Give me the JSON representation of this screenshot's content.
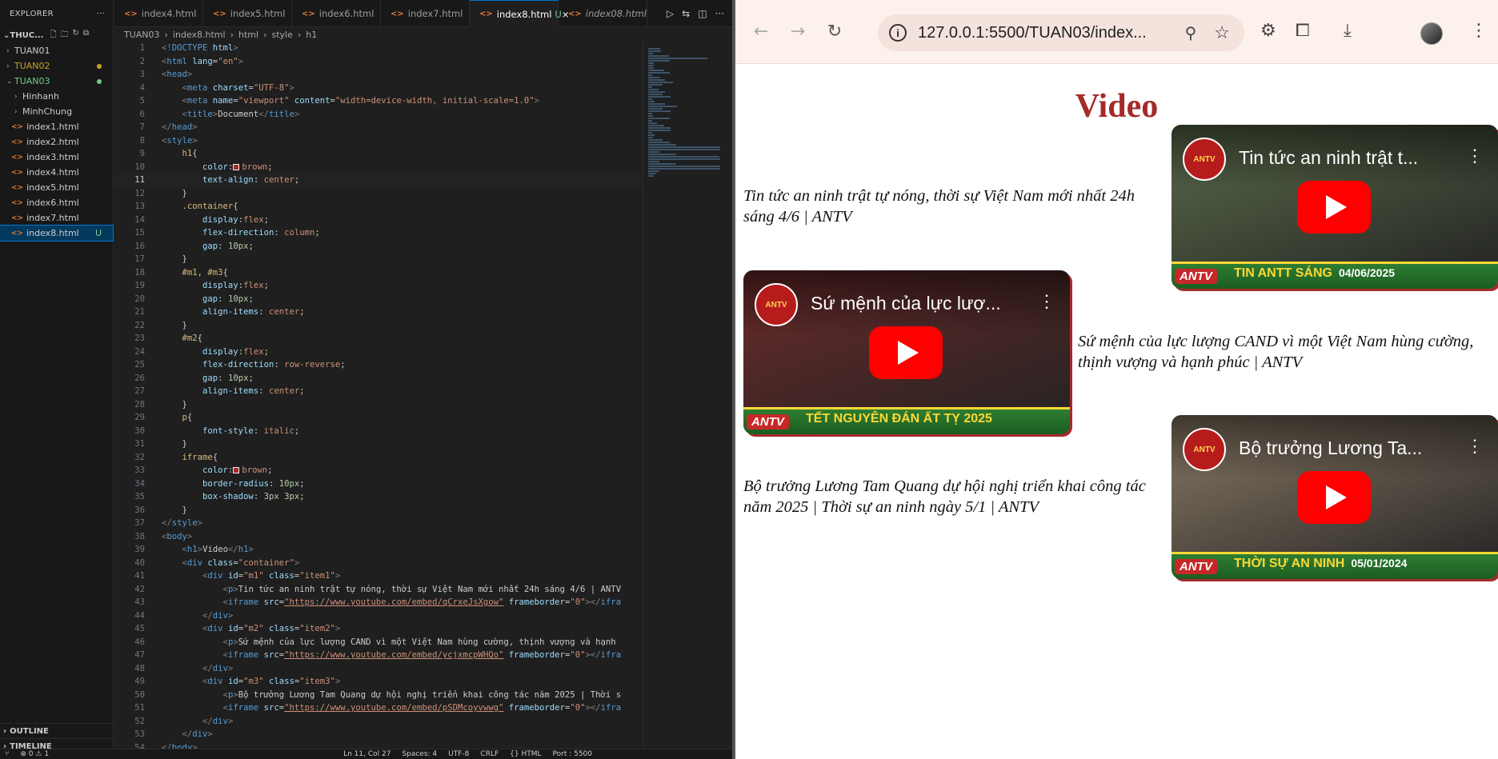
{
  "explorer": {
    "title": "EXPLORER",
    "root": "THUC...",
    "items": [
      {
        "label": "TUAN01",
        "kind": "folder",
        "color": "#cccccc"
      },
      {
        "label": "TUAN02",
        "kind": "folder",
        "color": "#c9a227"
      },
      {
        "label": "TUAN03",
        "kind": "folder-open",
        "color": "#73c991"
      },
      {
        "label": "Hinhanh",
        "kind": "folder",
        "color": "#cccccc"
      },
      {
        "label": "MinhChung",
        "kind": "folder",
        "color": "#cccccc"
      },
      {
        "label": "index1.html",
        "kind": "file",
        "color": "#cccccc"
      },
      {
        "label": "index2.html",
        "kind": "file",
        "color": "#cccccc"
      },
      {
        "label": "index3.html",
        "kind": "file",
        "color": "#cccccc"
      },
      {
        "label": "index4.html",
        "kind": "file",
        "color": "#cccccc"
      },
      {
        "label": "index5.html",
        "kind": "file",
        "color": "#cccccc"
      },
      {
        "label": "index6.html",
        "kind": "file",
        "color": "#cccccc"
      },
      {
        "label": "index7.html",
        "kind": "file",
        "color": "#cccccc"
      },
      {
        "label": "index8.html",
        "kind": "file",
        "color": "#cccccc",
        "badge": "U",
        "selected": true
      }
    ],
    "outline": "OUTLINE",
    "timeline": "TIMELINE"
  },
  "tabs": [
    {
      "label": "index4.html"
    },
    {
      "label": "index5.html"
    },
    {
      "label": "index6.html"
    },
    {
      "label": "index7.html"
    },
    {
      "label": "index8.html",
      "active": true,
      "badge": "U"
    },
    {
      "label": "index08.html",
      "italic": true
    }
  ],
  "breadcrumb": [
    "TUAN03",
    "index8.html",
    "html",
    "style",
    "h1"
  ],
  "code": {
    "current_line": 11,
    "lines": [
      [
        [
          "c-br",
          "<!"
        ],
        [
          "c-tag",
          "DOCTYPE"
        ],
        [
          "c-attr",
          " html"
        ],
        [
          "c-br",
          ">"
        ]
      ],
      [
        [
          "c-br",
          "<"
        ],
        [
          "c-tag",
          "html"
        ],
        [
          "c-attr",
          " lang"
        ],
        [
          "c-punc",
          "="
        ],
        [
          "c-str",
          "\"en\""
        ],
        [
          "c-br",
          ">"
        ]
      ],
      [
        [
          "c-br",
          "<"
        ],
        [
          "c-tag",
          "head"
        ],
        [
          "c-br",
          ">"
        ]
      ],
      [
        [
          "c-txt",
          "    "
        ],
        [
          "c-br",
          "<"
        ],
        [
          "c-tag",
          "meta"
        ],
        [
          "c-attr",
          " charset"
        ],
        [
          "c-punc",
          "="
        ],
        [
          "c-str",
          "\"UTF-8\""
        ],
        [
          "c-br",
          ">"
        ]
      ],
      [
        [
          "c-txt",
          "    "
        ],
        [
          "c-br",
          "<"
        ],
        [
          "c-tag",
          "meta"
        ],
        [
          "c-attr",
          " name"
        ],
        [
          "c-punc",
          "="
        ],
        [
          "c-str",
          "\"viewport\""
        ],
        [
          "c-attr",
          " content"
        ],
        [
          "c-punc",
          "="
        ],
        [
          "c-str",
          "\"width=device-width, initial-scale=1.0\""
        ],
        [
          "c-br",
          ">"
        ]
      ],
      [
        [
          "c-txt",
          "    "
        ],
        [
          "c-br",
          "<"
        ],
        [
          "c-tag",
          "title"
        ],
        [
          "c-br",
          ">"
        ],
        [
          "c-txt",
          "Document"
        ],
        [
          "c-br",
          "</"
        ],
        [
          "c-tag",
          "title"
        ],
        [
          "c-br",
          ">"
        ]
      ],
      [
        [
          "c-br",
          "</"
        ],
        [
          "c-tag",
          "head"
        ],
        [
          "c-br",
          ">"
        ]
      ],
      [
        [
          "c-br",
          "<"
        ],
        [
          "c-tag",
          "style"
        ],
        [
          "c-br",
          ">"
        ]
      ],
      [
        [
          "c-txt",
          "    "
        ],
        [
          "c-sel",
          "h1"
        ],
        [
          "c-punc",
          "{"
        ]
      ],
      [
        [
          "c-txt",
          "        "
        ],
        [
          "c-prop",
          "color"
        ],
        [
          "c-punc",
          ":"
        ],
        [
          "swatch",
          ""
        ],
        [
          "c-val",
          "brown"
        ],
        [
          "c-punc",
          ";"
        ]
      ],
      [
        [
          "c-txt",
          "        "
        ],
        [
          "c-prop",
          "text-align"
        ],
        [
          "c-punc",
          ": "
        ],
        [
          "c-val",
          "center"
        ],
        [
          "c-punc",
          ";"
        ]
      ],
      [
        [
          "c-txt",
          "    "
        ],
        [
          "c-punc",
          "}"
        ]
      ],
      [
        [
          "c-txt",
          "    "
        ],
        [
          "c-sel",
          ".container"
        ],
        [
          "c-punc",
          "{"
        ]
      ],
      [
        [
          "c-txt",
          "        "
        ],
        [
          "c-prop",
          "display"
        ],
        [
          "c-punc",
          ":"
        ],
        [
          "c-val",
          "flex"
        ],
        [
          "c-punc",
          ";"
        ]
      ],
      [
        [
          "c-txt",
          "        "
        ],
        [
          "c-prop",
          "flex-direction"
        ],
        [
          "c-punc",
          ": "
        ],
        [
          "c-val",
          "column"
        ],
        [
          "c-punc",
          ";"
        ]
      ],
      [
        [
          "c-txt",
          "        "
        ],
        [
          "c-prop",
          "gap"
        ],
        [
          "c-punc",
          ": "
        ],
        [
          "c-num",
          "10px"
        ],
        [
          "c-punc",
          ";"
        ]
      ],
      [
        [
          "c-txt",
          "    "
        ],
        [
          "c-punc",
          "}"
        ]
      ],
      [
        [
          "c-txt",
          "    "
        ],
        [
          "c-sel",
          "#m1, #m3"
        ],
        [
          "c-punc",
          "{"
        ]
      ],
      [
        [
          "c-txt",
          "        "
        ],
        [
          "c-prop",
          "display"
        ],
        [
          "c-punc",
          ":"
        ],
        [
          "c-val",
          "flex"
        ],
        [
          "c-punc",
          ";"
        ]
      ],
      [
        [
          "c-txt",
          "        "
        ],
        [
          "c-prop",
          "gap"
        ],
        [
          "c-punc",
          ": "
        ],
        [
          "c-num",
          "10px"
        ],
        [
          "c-punc",
          ";"
        ]
      ],
      [
        [
          "c-txt",
          "        "
        ],
        [
          "c-prop",
          "align-items"
        ],
        [
          "c-punc",
          ": "
        ],
        [
          "c-val",
          "center"
        ],
        [
          "c-punc",
          ";"
        ]
      ],
      [
        [
          "c-txt",
          "    "
        ],
        [
          "c-punc",
          "}"
        ]
      ],
      [
        [
          "c-txt",
          "    "
        ],
        [
          "c-sel",
          "#m2"
        ],
        [
          "c-punc",
          "{"
        ]
      ],
      [
        [
          "c-txt",
          "        "
        ],
        [
          "c-prop",
          "display"
        ],
        [
          "c-punc",
          ":"
        ],
        [
          "c-val",
          "flex"
        ],
        [
          "c-punc",
          ";"
        ]
      ],
      [
        [
          "c-txt",
          "        "
        ],
        [
          "c-prop",
          "flex-direction"
        ],
        [
          "c-punc",
          ": "
        ],
        [
          "c-val",
          "row-reverse"
        ],
        [
          "c-punc",
          ";"
        ]
      ],
      [
        [
          "c-txt",
          "        "
        ],
        [
          "c-prop",
          "gap"
        ],
        [
          "c-punc",
          ": "
        ],
        [
          "c-num",
          "10px"
        ],
        [
          "c-punc",
          ";"
        ]
      ],
      [
        [
          "c-txt",
          "        "
        ],
        [
          "c-prop",
          "align-items"
        ],
        [
          "c-punc",
          ": "
        ],
        [
          "c-val",
          "center"
        ],
        [
          "c-punc",
          ";"
        ]
      ],
      [
        [
          "c-txt",
          "    "
        ],
        [
          "c-punc",
          "}"
        ]
      ],
      [
        [
          "c-txt",
          "    "
        ],
        [
          "c-sel",
          "p"
        ],
        [
          "c-punc",
          "{"
        ]
      ],
      [
        [
          "c-txt",
          "        "
        ],
        [
          "c-prop",
          "font-style"
        ],
        [
          "c-punc",
          ": "
        ],
        [
          "c-val",
          "italic"
        ],
        [
          "c-punc",
          ";"
        ]
      ],
      [
        [
          "c-txt",
          "    "
        ],
        [
          "c-punc",
          "}"
        ]
      ],
      [
        [
          "c-txt",
          "    "
        ],
        [
          "c-sel",
          "iframe"
        ],
        [
          "c-punc",
          "{"
        ]
      ],
      [
        [
          "c-txt",
          "        "
        ],
        [
          "c-prop",
          "color"
        ],
        [
          "c-punc",
          ":"
        ],
        [
          "swatch",
          ""
        ],
        [
          "c-val",
          "brown"
        ],
        [
          "c-punc",
          ";"
        ]
      ],
      [
        [
          "c-txt",
          "        "
        ],
        [
          "c-prop",
          "border-radius"
        ],
        [
          "c-punc",
          ": "
        ],
        [
          "c-num",
          "10px"
        ],
        [
          "c-punc",
          ";"
        ]
      ],
      [
        [
          "c-txt",
          "        "
        ],
        [
          "c-prop",
          "box-shadow"
        ],
        [
          "c-punc",
          ": "
        ],
        [
          "c-num",
          "3px 3px"
        ],
        [
          "c-punc",
          ";"
        ]
      ],
      [
        [
          "c-txt",
          "    "
        ],
        [
          "c-punc",
          "}"
        ]
      ],
      [
        [
          "c-br",
          "</"
        ],
        [
          "c-tag",
          "style"
        ],
        [
          "c-br",
          ">"
        ]
      ],
      [
        [
          "c-br",
          "<"
        ],
        [
          "c-tag",
          "body"
        ],
        [
          "c-br",
          ">"
        ]
      ],
      [
        [
          "c-txt",
          "    "
        ],
        [
          "c-br",
          "<"
        ],
        [
          "c-tag",
          "h1"
        ],
        [
          "c-br",
          ">"
        ],
        [
          "c-txt",
          "Video"
        ],
        [
          "c-br",
          "</"
        ],
        [
          "c-tag",
          "h1"
        ],
        [
          "c-br",
          ">"
        ]
      ],
      [
        [
          "c-txt",
          "    "
        ],
        [
          "c-br",
          "<"
        ],
        [
          "c-tag",
          "div"
        ],
        [
          "c-attr",
          " class"
        ],
        [
          "c-punc",
          "="
        ],
        [
          "c-str",
          "\"container\""
        ],
        [
          "c-br",
          ">"
        ]
      ],
      [
        [
          "c-txt",
          "        "
        ],
        [
          "c-br",
          "<"
        ],
        [
          "c-tag",
          "div"
        ],
        [
          "c-attr",
          " id"
        ],
        [
          "c-punc",
          "="
        ],
        [
          "c-str",
          "\"m1\""
        ],
        [
          "c-attr",
          " class"
        ],
        [
          "c-punc",
          "="
        ],
        [
          "c-str",
          "\"item1\""
        ],
        [
          "c-br",
          ">"
        ]
      ],
      [
        [
          "c-txt",
          "            "
        ],
        [
          "c-br",
          "<"
        ],
        [
          "c-tag",
          "p"
        ],
        [
          "c-br",
          ">"
        ],
        [
          "c-txt",
          "Tin tức an ninh trật tự nóng, thời sự Việt Nam mới nhất 24h sáng 4/6 | ANTV"
        ]
      ],
      [
        [
          "c-txt",
          "            "
        ],
        [
          "c-br",
          "<"
        ],
        [
          "c-tag",
          "iframe"
        ],
        [
          "c-attr",
          " src"
        ],
        [
          "c-punc",
          "="
        ],
        [
          "c-url",
          "\"https://www.youtube.com/embed/qCrxeJsXgow\""
        ],
        [
          "c-attr",
          " frameborder"
        ],
        [
          "c-punc",
          "="
        ],
        [
          "c-str",
          "\"0\""
        ],
        [
          "c-br",
          "></"
        ],
        [
          "c-tag",
          "ifra"
        ]
      ],
      [
        [
          "c-txt",
          "        "
        ],
        [
          "c-br",
          "</"
        ],
        [
          "c-tag",
          "div"
        ],
        [
          "c-br",
          ">"
        ]
      ],
      [
        [
          "c-txt",
          "        "
        ],
        [
          "c-br",
          "<"
        ],
        [
          "c-tag",
          "div"
        ],
        [
          "c-attr",
          " id"
        ],
        [
          "c-punc",
          "="
        ],
        [
          "c-str",
          "\"m2\""
        ],
        [
          "c-attr",
          " class"
        ],
        [
          "c-punc",
          "="
        ],
        [
          "c-str",
          "\"item2\""
        ],
        [
          "c-br",
          ">"
        ]
      ],
      [
        [
          "c-txt",
          "            "
        ],
        [
          "c-br",
          "<"
        ],
        [
          "c-tag",
          "p"
        ],
        [
          "c-br",
          ">"
        ],
        [
          "c-txt",
          "Sứ mệnh của lực lượng CAND vì một Việt Nam hùng cường, thịnh vượng và hạnh"
        ]
      ],
      [
        [
          "c-txt",
          "            "
        ],
        [
          "c-br",
          "<"
        ],
        [
          "c-tag",
          "iframe"
        ],
        [
          "c-attr",
          " src"
        ],
        [
          "c-punc",
          "="
        ],
        [
          "c-url",
          "\"https://www.youtube.com/embed/ycjxmcpWHQo\""
        ],
        [
          "c-attr",
          " frameborder"
        ],
        [
          "c-punc",
          "="
        ],
        [
          "c-str",
          "\"0\""
        ],
        [
          "c-br",
          "></"
        ],
        [
          "c-tag",
          "ifra"
        ]
      ],
      [
        [
          "c-txt",
          "        "
        ],
        [
          "c-br",
          "</"
        ],
        [
          "c-tag",
          "div"
        ],
        [
          "c-br",
          ">"
        ]
      ],
      [
        [
          "c-txt",
          "        "
        ],
        [
          "c-br",
          "<"
        ],
        [
          "c-tag",
          "div"
        ],
        [
          "c-attr",
          " id"
        ],
        [
          "c-punc",
          "="
        ],
        [
          "c-str",
          "\"m3\""
        ],
        [
          "c-attr",
          " class"
        ],
        [
          "c-punc",
          "="
        ],
        [
          "c-str",
          "\"item3\""
        ],
        [
          "c-br",
          ">"
        ]
      ],
      [
        [
          "c-txt",
          "            "
        ],
        [
          "c-br",
          "<"
        ],
        [
          "c-tag",
          "p"
        ],
        [
          "c-br",
          ">"
        ],
        [
          "c-txt",
          "Bộ trưởng Lương Tam Quang dự hội nghị triển khai công tác năm 2025 | Thời s"
        ]
      ],
      [
        [
          "c-txt",
          "            "
        ],
        [
          "c-br",
          "<"
        ],
        [
          "c-tag",
          "iframe"
        ],
        [
          "c-attr",
          " src"
        ],
        [
          "c-punc",
          "="
        ],
        [
          "c-url",
          "\"https://www.youtube.com/embed/pSDMcoyvwwg\""
        ],
        [
          "c-attr",
          " frameborder"
        ],
        [
          "c-punc",
          "="
        ],
        [
          "c-str",
          "\"0\""
        ],
        [
          "c-br",
          "></"
        ],
        [
          "c-tag",
          "ifra"
        ]
      ],
      [
        [
          "c-txt",
          "        "
        ],
        [
          "c-br",
          "</"
        ],
        [
          "c-tag",
          "div"
        ],
        [
          "c-br",
          ">"
        ]
      ],
      [
        [
          "c-txt",
          "    "
        ],
        [
          "c-br",
          "</"
        ],
        [
          "c-tag",
          "div"
        ],
        [
          "c-br",
          ">"
        ]
      ],
      [
        [
          "c-br",
          "</"
        ],
        [
          "c-tag",
          "body"
        ],
        [
          "c-br",
          ">"
        ]
      ]
    ]
  },
  "statusbar": [
    "Ln 11, Col 27",
    "Spaces: 4",
    "UTF-8",
    "CRLF",
    "{} HTML",
    "Port : 5500"
  ],
  "browser": {
    "url": "127.0.0.1:5500/TUAN03/index...",
    "page": {
      "heading": "Video",
      "videos": [
        {
          "text": "Tin tức an ninh trật tự nóng, thời sự Việt Nam mới nhất 24h sáng 4/6 | ANTV",
          "title": "Tin tức an ninh trật t...",
          "caption": "TIN ANTT SÁNG",
          "date": "04/06/2025",
          "bg": "#5a6b4a"
        },
        {
          "text": "Sứ mệnh của lực lượng CAND vì một Việt Nam hùng cường, thịnh vượng và hạnh phúc | ANTV",
          "title": "Sứ mệnh của lực lượ...",
          "caption": "TẾT NGUYÊN ĐÁN ẤT TỴ 2025",
          "date": "",
          "bg": "#6b2a2a"
        },
        {
          "text": "Bộ trưởng Lương Tam Quang dự hội nghị triển khai công tác năm 2025 | Thời sự an ninh ngày 5/1 | ANTV",
          "title": "Bộ trưởng Lương Ta...",
          "caption": "THỜI SỰ AN NINH",
          "date": "05/01/2024",
          "bg": "#8a7a66"
        }
      ],
      "logo_text": "ANTV",
      "heading_color": "#a52a2a"
    }
  }
}
